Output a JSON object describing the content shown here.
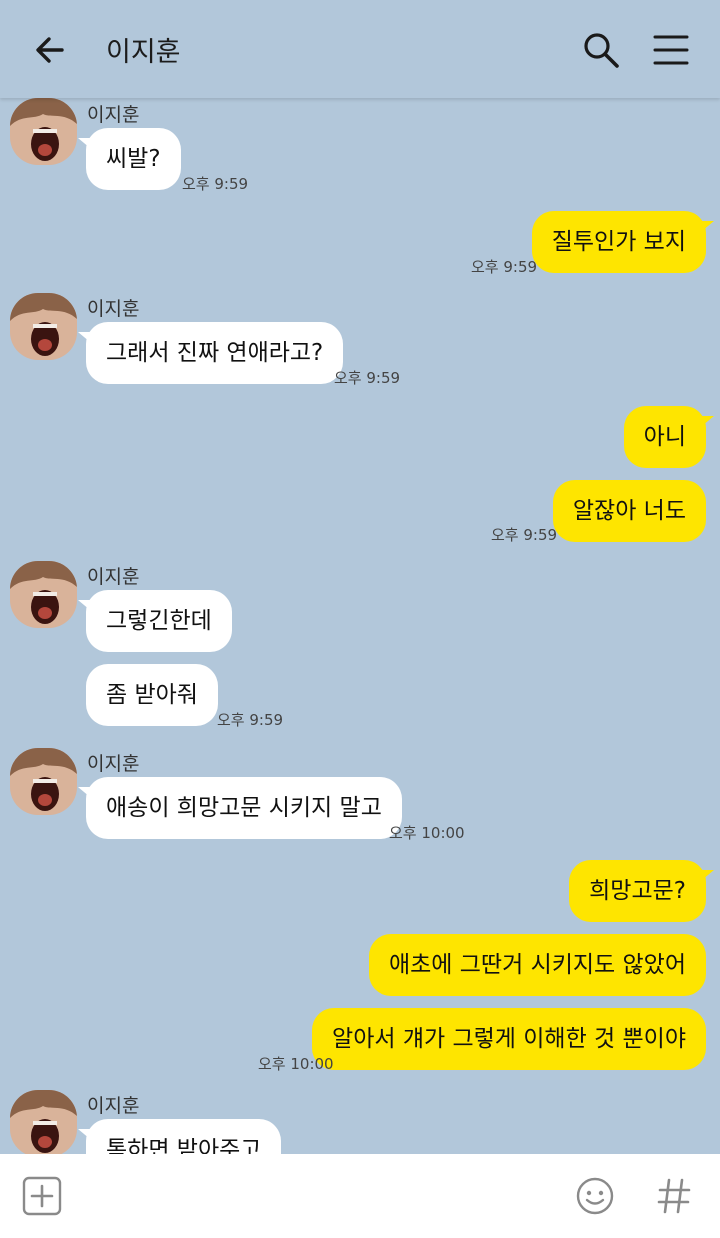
{
  "header": {
    "title": "이지훈",
    "back_icon": "arrow-left-icon",
    "search_icon": "search-icon",
    "menu_icon": "hamburger-menu-icon"
  },
  "messages": [
    {
      "name": "이지훈",
      "text": "씨발?",
      "time": "오후 9:59"
    },
    {
      "text": "질투인가 보지",
      "time": "오후 9:59"
    },
    {
      "name": "이지훈",
      "text": "그래서 진짜 연애라고?",
      "time": "오후 9:59"
    },
    {
      "text": "아니"
    },
    {
      "text": "알잖아 너도",
      "time": "오후 9:59"
    },
    {
      "name": "이지훈",
      "text": "그렇긴한데"
    },
    {
      "text": "좀 받아줘",
      "time": "오후 9:59"
    },
    {
      "name": "이지훈",
      "text": "애송이 희망고문 시키지 말고",
      "time": "오후 10:00"
    },
    {
      "text": "희망고문?"
    },
    {
      "text": "애초에 그딴거 시키지도 않았어"
    },
    {
      "text": "알아서 걔가 그렇게 이해한 것 뿐이야",
      "time": "오후 10:00"
    },
    {
      "name": "이지훈",
      "text": "톡하면 받아주고"
    }
  ],
  "input_bar": {
    "plus_icon": "add-box-icon",
    "emoji_icon": "emoji-icon",
    "hash_icon": "hash-icon"
  }
}
